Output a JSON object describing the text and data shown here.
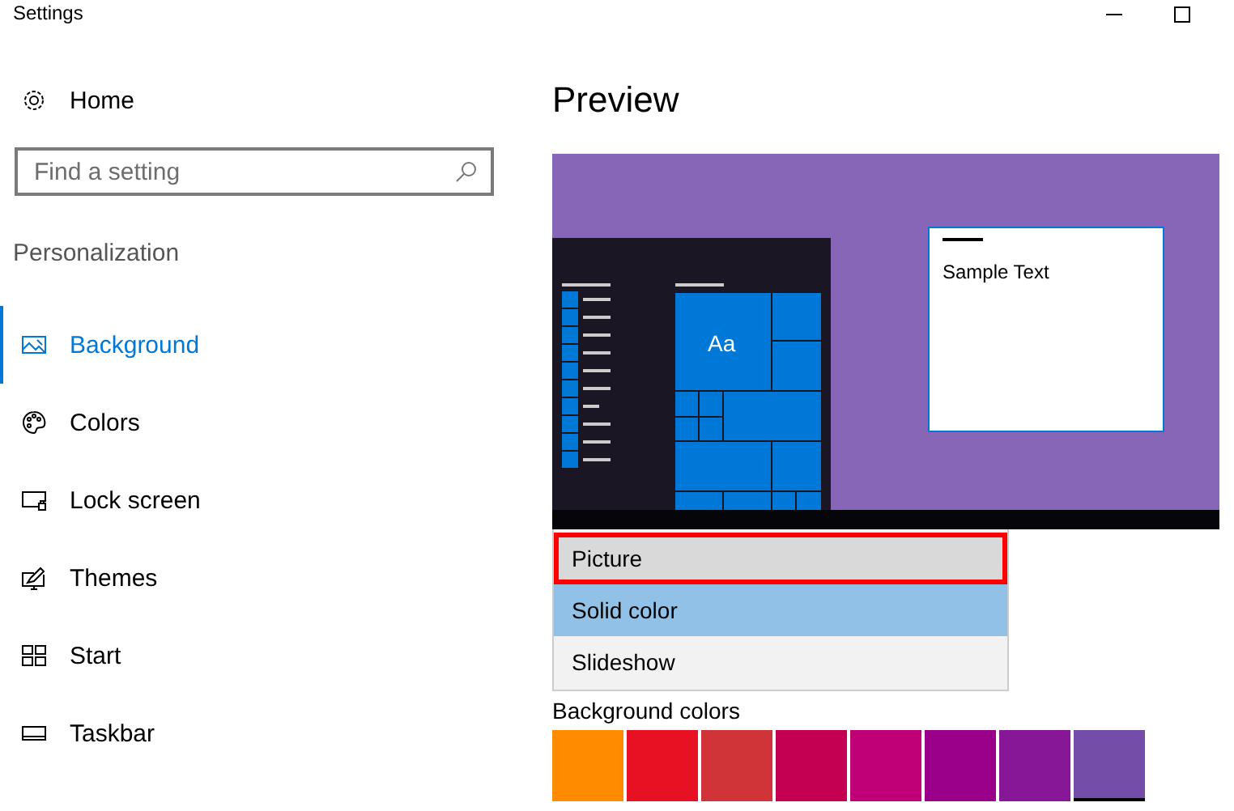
{
  "window": {
    "title": "Settings"
  },
  "sidebar": {
    "home": "Home",
    "search": {
      "placeholder": "Find a setting"
    },
    "section": "Personalization",
    "items": [
      {
        "label": "Background",
        "selected": true
      },
      {
        "label": "Colors",
        "selected": false
      },
      {
        "label": "Lock screen",
        "selected": false
      },
      {
        "label": "Themes",
        "selected": false
      },
      {
        "label": "Start",
        "selected": false
      },
      {
        "label": "Taskbar",
        "selected": false
      }
    ]
  },
  "preview": {
    "heading": "Preview",
    "tile_label": "Aa",
    "sample_text": "Sample Text"
  },
  "dropdown": {
    "options": [
      {
        "label": "Picture",
        "selected": false,
        "highlighted": true
      },
      {
        "label": "Solid color",
        "selected": true,
        "highlighted": false
      },
      {
        "label": "Slideshow",
        "selected": false,
        "highlighted": false
      }
    ]
  },
  "colors": {
    "heading": "Background colors",
    "swatches": [
      {
        "color": "#ff8c00",
        "selected": false
      },
      {
        "color": "#e81123",
        "selected": false
      },
      {
        "color": "#d13438",
        "selected": false
      },
      {
        "color": "#c30052",
        "selected": false
      },
      {
        "color": "#bf0077",
        "selected": false
      },
      {
        "color": "#9a0089",
        "selected": false
      },
      {
        "color": "#881798",
        "selected": false
      },
      {
        "color": "#744da9",
        "selected": true
      }
    ]
  }
}
